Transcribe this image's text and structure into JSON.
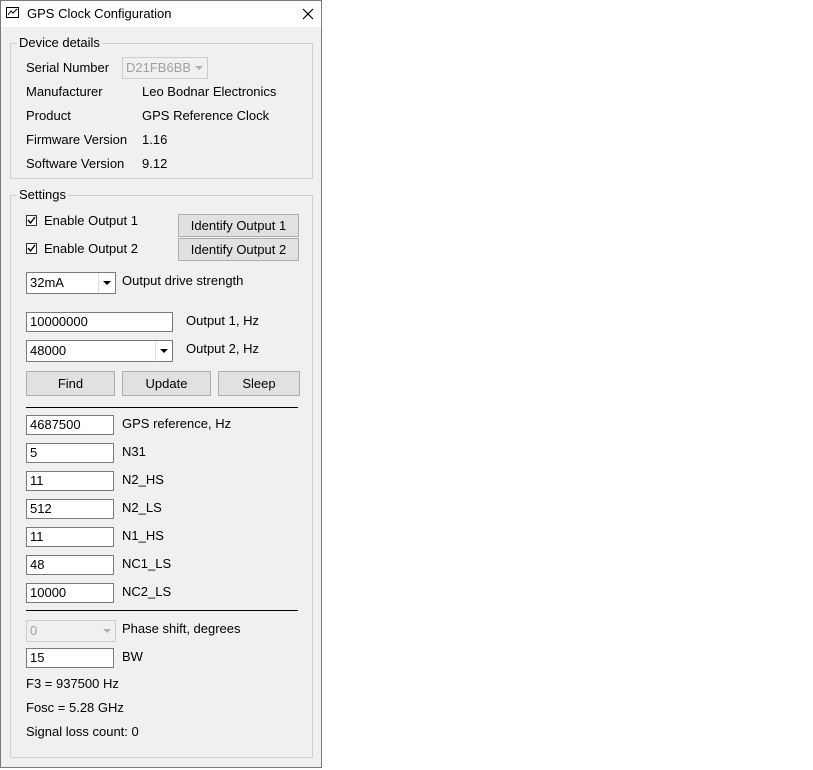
{
  "window": {
    "title": "GPS Clock Configuration"
  },
  "device_details": {
    "legend": "Device details",
    "serial_number_label": "Serial Number",
    "serial_number_value": "D21FB6BB",
    "manufacturer_label": "Manufacturer",
    "manufacturer_value": "Leo Bodnar Electronics",
    "product_label": "Product",
    "product_value": "GPS Reference Clock",
    "firmware_label": "Firmware Version",
    "firmware_value": "1.16",
    "software_label": "Software Version",
    "software_value": "9.12"
  },
  "settings": {
    "legend": "Settings",
    "enable_output1": {
      "label": "Enable Output 1",
      "checked": true
    },
    "enable_output2": {
      "label": "Enable Output 2",
      "checked": true
    },
    "identify_output1": "Identify Output 1",
    "identify_output2": "Identify Output 2",
    "drive_strength": {
      "value": "32mA",
      "label": "Output drive strength"
    },
    "output1_hz": {
      "value": "10000000",
      "label": "Output 1, Hz"
    },
    "output2_hz": {
      "value": "48000",
      "label": "Output 2, Hz"
    },
    "buttons": {
      "find": "Find",
      "update": "Update",
      "sleep": "Sleep"
    },
    "gps_reference": {
      "value": "4687500",
      "label": "GPS reference, Hz"
    },
    "n31": {
      "value": "5",
      "label": "N31"
    },
    "n2_hs": {
      "value": "11",
      "label": "N2_HS"
    },
    "n2_ls": {
      "value": "512",
      "label": "N2_LS"
    },
    "n1_hs": {
      "value": "11",
      "label": "N1_HS"
    },
    "nc1_ls": {
      "value": "48",
      "label": "NC1_LS"
    },
    "nc2_ls": {
      "value": "10000",
      "label": "NC2_LS"
    },
    "phase_shift": {
      "value": "0",
      "label": "Phase shift, degrees"
    },
    "bw": {
      "value": "15",
      "label": "BW"
    },
    "f3": "F3 = 937500 Hz",
    "fosc": "Fosc = 5.28 GHz",
    "signal_loss": "Signal loss count: 0"
  },
  "icons": {
    "app": "app-monitor-icon",
    "close": "close-icon",
    "check": "checkmark-icon",
    "dropdown": "chevron-down-icon"
  }
}
